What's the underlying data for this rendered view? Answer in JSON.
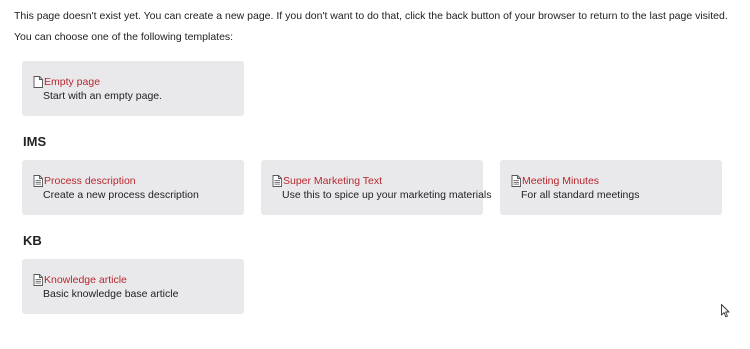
{
  "intro": {
    "line1": "This page doesn't exist yet. You can create a new page. If you don't want to do that, click the back button of your browser to return to the last page visited.",
    "line2": "You can choose one of the following templates:"
  },
  "default_template": {
    "title": "Empty page",
    "description": "Start with an empty page.",
    "icon": "blank-page-icon"
  },
  "sections": [
    {
      "name": "IMS",
      "templates": [
        {
          "title": "Process description",
          "description": "Create a new process description",
          "icon": "document-icon"
        },
        {
          "title": "Super Marketing Text",
          "description": "Use this to spice up your marketing materials",
          "icon": "document-icon"
        },
        {
          "title": "Meeting Minutes",
          "description": "For all standard meetings",
          "icon": "document-icon"
        }
      ]
    },
    {
      "name": "KB",
      "templates": [
        {
          "title": "Knowledge article",
          "description": "Basic knowledge base article",
          "icon": "document-icon"
        }
      ]
    }
  ],
  "colors": {
    "link": "#b7282e",
    "card_bg": "#e9e9ec",
    "text": "#222222"
  }
}
